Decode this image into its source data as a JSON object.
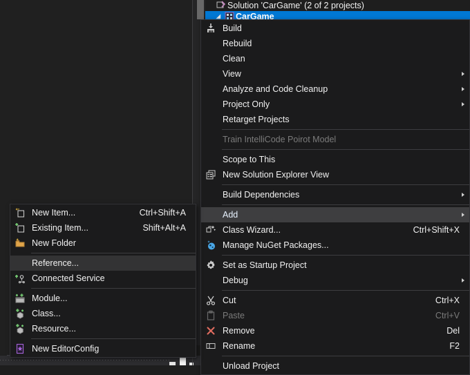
{
  "app": {
    "theme_bg": "#1e1e1e",
    "menu_bg": "#1b1b1c",
    "highlight_bg": "#3e3e40",
    "selection_blue": "#0078d4",
    "accent_text": "#e8f2ff",
    "disabled_text": "#7b7b7b"
  },
  "solution_explorer": {
    "rows": [
      {
        "label": "Solution 'CarGame' (2 of 2 projects)",
        "icon": "solution-icon",
        "selected": false,
        "twisty": ""
      },
      {
        "label": "CarGame",
        "icon": "cpp-project-icon",
        "selected": true,
        "twisty": "◢"
      }
    ]
  },
  "context_menu": {
    "name": "project-context-menu",
    "items": [
      {
        "label": "Build",
        "icon": "build-icon",
        "accel": "",
        "submenu": false,
        "disabled": false,
        "highlight": ""
      },
      {
        "label": "Rebuild",
        "icon": "",
        "accel": "",
        "submenu": false,
        "disabled": false,
        "highlight": ""
      },
      {
        "label": "Clean",
        "icon": "",
        "accel": "",
        "submenu": false,
        "disabled": false,
        "highlight": ""
      },
      {
        "label": "View",
        "icon": "",
        "accel": "",
        "submenu": true,
        "disabled": false,
        "highlight": ""
      },
      {
        "label": "Analyze and Code Cleanup",
        "icon": "",
        "accel": "",
        "submenu": true,
        "disabled": false,
        "highlight": ""
      },
      {
        "label": "Project Only",
        "icon": "",
        "accel": "",
        "submenu": true,
        "disabled": false,
        "highlight": ""
      },
      {
        "label": "Retarget Projects",
        "icon": "",
        "accel": "",
        "submenu": false,
        "disabled": false,
        "highlight": ""
      },
      {
        "separator": true
      },
      {
        "label": "Train IntelliCode Poirot Model",
        "icon": "",
        "accel": "",
        "submenu": false,
        "disabled": true,
        "highlight": ""
      },
      {
        "separator": true
      },
      {
        "label": "Scope to This",
        "icon": "",
        "accel": "",
        "submenu": false,
        "disabled": false,
        "highlight": ""
      },
      {
        "label": "New Solution Explorer View",
        "icon": "new-view-icon",
        "accel": "",
        "submenu": false,
        "disabled": false,
        "highlight": ""
      },
      {
        "separator": true
      },
      {
        "label": "Build Dependencies",
        "icon": "",
        "accel": "",
        "submenu": true,
        "disabled": false,
        "highlight": ""
      },
      {
        "separator": true
      },
      {
        "label": "Add",
        "icon": "",
        "accel": "",
        "submenu": true,
        "disabled": false,
        "highlight": "open"
      },
      {
        "label": "Class Wizard...",
        "icon": "class-wizard-icon",
        "accel": "Ctrl+Shift+X",
        "submenu": false,
        "disabled": false,
        "highlight": ""
      },
      {
        "label": "Manage NuGet Packages...",
        "icon": "nuget-icon",
        "accel": "",
        "submenu": false,
        "disabled": false,
        "highlight": ""
      },
      {
        "separator": true
      },
      {
        "label": "Set as Startup Project",
        "icon": "gear-icon",
        "accel": "",
        "submenu": false,
        "disabled": false,
        "highlight": ""
      },
      {
        "label": "Debug",
        "icon": "",
        "accel": "",
        "submenu": true,
        "disabled": false,
        "highlight": ""
      },
      {
        "separator": true
      },
      {
        "label": "Cut",
        "icon": "cut-icon",
        "accel": "Ctrl+X",
        "submenu": false,
        "disabled": false,
        "highlight": ""
      },
      {
        "label": "Paste",
        "icon": "paste-icon",
        "accel": "Ctrl+V",
        "submenu": false,
        "disabled": true,
        "highlight": ""
      },
      {
        "label": "Remove",
        "icon": "remove-icon",
        "accel": "Del",
        "submenu": false,
        "disabled": false,
        "highlight": ""
      },
      {
        "label": "Rename",
        "icon": "rename-icon",
        "accel": "F2",
        "submenu": false,
        "disabled": false,
        "highlight": ""
      },
      {
        "separator": true
      },
      {
        "label": "Unload Project",
        "icon": "",
        "accel": "",
        "submenu": false,
        "disabled": false,
        "highlight": ""
      }
    ]
  },
  "add_submenu": {
    "name": "add-submenu",
    "items": [
      {
        "label": "New Item...",
        "icon": "new-item-icon",
        "accel": "Ctrl+Shift+A",
        "submenu": false,
        "disabled": false,
        "highlight": ""
      },
      {
        "label": "Existing Item...",
        "icon": "existing-item-icon",
        "accel": "Shift+Alt+A",
        "submenu": false,
        "disabled": false,
        "highlight": ""
      },
      {
        "label": "New Folder",
        "icon": "new-folder-icon",
        "accel": "",
        "submenu": false,
        "disabled": false,
        "highlight": ""
      },
      {
        "separator": true
      },
      {
        "label": "Reference...",
        "icon": "",
        "accel": "",
        "submenu": false,
        "disabled": false,
        "highlight": "hover"
      },
      {
        "label": "Connected Service",
        "icon": "connected-service-icon",
        "accel": "",
        "submenu": false,
        "disabled": false,
        "highlight": ""
      },
      {
        "separator": true
      },
      {
        "label": "Module...",
        "icon": "module-icon",
        "accel": "",
        "submenu": false,
        "disabled": false,
        "highlight": ""
      },
      {
        "label": "Class...",
        "icon": "class-icon",
        "accel": "",
        "submenu": false,
        "disabled": false,
        "highlight": ""
      },
      {
        "label": "Resource...",
        "icon": "resource-icon",
        "accel": "",
        "submenu": false,
        "disabled": false,
        "highlight": ""
      },
      {
        "separator": true
      },
      {
        "label": "New EditorConfig",
        "icon": "editorconfig-icon",
        "accel": "",
        "submenu": false,
        "disabled": false,
        "highlight": ""
      }
    ]
  }
}
